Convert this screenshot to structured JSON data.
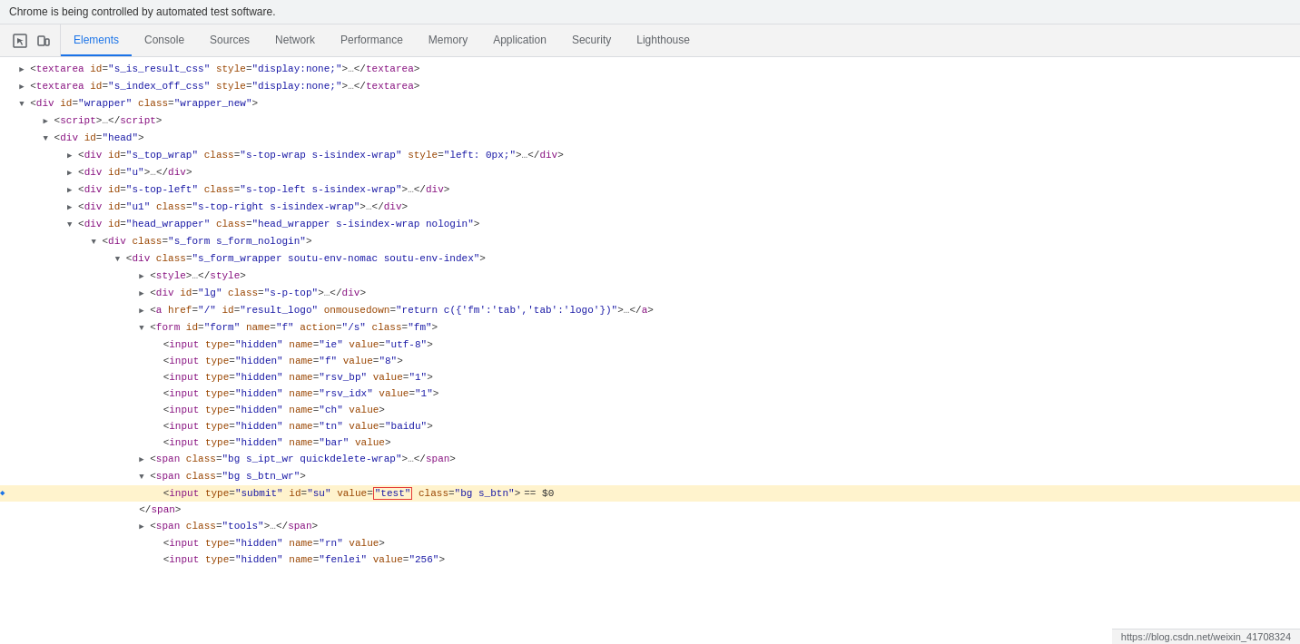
{
  "banner": {
    "text": "Chrome is being controlled by automated test software."
  },
  "toolbar": {
    "icons": [
      {
        "name": "cursor-icon",
        "symbol": "⬚"
      },
      {
        "name": "device-icon",
        "symbol": "▣"
      }
    ],
    "tabs": [
      {
        "id": "elements",
        "label": "Elements",
        "active": true
      },
      {
        "id": "console",
        "label": "Console",
        "active": false
      },
      {
        "id": "sources",
        "label": "Sources",
        "active": false
      },
      {
        "id": "network",
        "label": "Network",
        "active": false
      },
      {
        "id": "performance",
        "label": "Performance",
        "active": false
      },
      {
        "id": "memory",
        "label": "Memory",
        "active": false
      },
      {
        "id": "application",
        "label": "Application",
        "active": false
      },
      {
        "id": "security",
        "label": "Security",
        "active": false
      },
      {
        "id": "lighthouse",
        "label": "Lighthouse",
        "active": false
      }
    ]
  },
  "statusBar": {
    "url": "https://blog.csdn.net/weixin_41708324"
  },
  "codeLines": [
    {
      "indent": 0,
      "expanded": false,
      "marker": false,
      "highlighted": false,
      "html": "<span class='triangle triangle-right'></span><span class='bracket'>&lt;</span><span class='tag'>textarea</span> <span class='attr-name'>id</span><span class='equals'>=</span><span class='attr-value'>\"s_is_result_css\"</span> <span class='attr-name'>style</span><span class='equals'>=</span><span class='attr-value'>\"display:none;\"</span><span class='bracket'>&gt;</span><span class='ellipsis'>…</span><span class='bracket'>&lt;/</span><span class='tag'>textarea</span><span class='bracket'>&gt;</span>"
    },
    {
      "indent": 0,
      "expanded": false,
      "marker": false,
      "highlighted": false,
      "html": "<span class='triangle triangle-right'></span><span class='bracket'>&lt;</span><span class='tag'>textarea</span> <span class='attr-name'>id</span><span class='equals'>=</span><span class='attr-value'>\"s_index_off_css\"</span> <span class='attr-name'>style</span><span class='equals'>=</span><span class='attr-value'>\"display:none;\"</span><span class='bracket'>&gt;</span><span class='ellipsis'>…</span><span class='bracket'>&lt;/</span><span class='tag'>textarea</span><span class='bracket'>&gt;</span>"
    },
    {
      "indent": 0,
      "expanded": true,
      "marker": false,
      "highlighted": false,
      "html": "<span class='triangle triangle-down'></span><span class='bracket'>&lt;</span><span class='tag'>div</span> <span class='attr-name'>id</span><span class='equals'>=</span><span class='attr-value'>\"wrapper\"</span> <span class='attr-name'>class</span><span class='equals'>=</span><span class='attr-value'>\"wrapper_new\"</span><span class='bracket'>&gt;</span>"
    },
    {
      "indent": 1,
      "expanded": false,
      "marker": false,
      "highlighted": false,
      "html": "<span class='triangle triangle-right'></span><span class='bracket'>&lt;</span><span class='tag'>script</span><span class='bracket'>&gt;</span><span class='ellipsis'>…</span><span class='bracket'>&lt;/</span><span class='tag'>script</span><span class='bracket'>&gt;</span>"
    },
    {
      "indent": 1,
      "expanded": true,
      "marker": false,
      "highlighted": false,
      "html": "<span class='triangle triangle-down'></span><span class='bracket'>&lt;</span><span class='tag'>div</span> <span class='attr-name'>id</span><span class='equals'>=</span><span class='attr-value'>\"head\"</span><span class='bracket'>&gt;</span>"
    },
    {
      "indent": 2,
      "expanded": false,
      "marker": false,
      "highlighted": false,
      "html": "<span class='triangle triangle-right'></span><span class='bracket'>&lt;</span><span class='tag'>div</span> <span class='attr-name'>id</span><span class='equals'>=</span><span class='attr-value'>\"s_top_wrap\"</span> <span class='attr-name'>class</span><span class='equals'>=</span><span class='attr-value'>\"s-top-wrap s-isindex-wrap\"</span> <span class='attr-name'>style</span><span class='equals'>=</span><span class='attr-value'>\"left: 0px;\"</span><span class='bracket'>&gt;</span><span class='ellipsis'>…</span><span class='bracket'>&lt;/</span><span class='tag'>div</span><span class='bracket'>&gt;</span>"
    },
    {
      "indent": 2,
      "expanded": false,
      "marker": false,
      "highlighted": false,
      "html": "<span class='triangle triangle-right'></span><span class='bracket'>&lt;</span><span class='tag'>div</span> <span class='attr-name'>id</span><span class='equals'>=</span><span class='attr-value'>\"u\"</span><span class='bracket'>&gt;</span><span class='ellipsis'>…</span><span class='bracket'>&lt;/</span><span class='tag'>div</span><span class='bracket'>&gt;</span>"
    },
    {
      "indent": 2,
      "expanded": false,
      "marker": false,
      "highlighted": false,
      "html": "<span class='triangle triangle-right'></span><span class='bracket'>&lt;</span><span class='tag'>div</span> <span class='attr-name'>id</span><span class='equals'>=</span><span class='attr-value'>\"s-top-left\"</span> <span class='attr-name'>class</span><span class='equals'>=</span><span class='attr-value'>\"s-top-left s-isindex-wrap\"</span><span class='bracket'>&gt;</span><span class='ellipsis'>…</span><span class='bracket'>&lt;/</span><span class='tag'>div</span><span class='bracket'>&gt;</span>"
    },
    {
      "indent": 2,
      "expanded": false,
      "marker": false,
      "highlighted": false,
      "html": "<span class='triangle triangle-right'></span><span class='bracket'>&lt;</span><span class='tag'>div</span> <span class='attr-name'>id</span><span class='equals'>=</span><span class='attr-value'>\"u1\"</span> <span class='attr-name'>class</span><span class='equals'>=</span><span class='attr-value'>\"s-top-right s-isindex-wrap\"</span><span class='bracket'>&gt;</span><span class='ellipsis'>…</span><span class='bracket'>&lt;/</span><span class='tag'>div</span><span class='bracket'>&gt;</span>"
    },
    {
      "indent": 2,
      "expanded": true,
      "marker": false,
      "highlighted": false,
      "html": "<span class='triangle triangle-down'></span><span class='bracket'>&lt;</span><span class='tag'>div</span> <span class='attr-name'>id</span><span class='equals'>=</span><span class='attr-value'>\"head_wrapper\"</span> <span class='attr-name'>class</span><span class='equals'>=</span><span class='attr-value'>\"head_wrapper s-isindex-wrap nologin\"</span><span class='bracket'>&gt;</span>"
    },
    {
      "indent": 3,
      "expanded": true,
      "marker": false,
      "highlighted": false,
      "html": "<span class='triangle triangle-down'></span><span class='bracket'>&lt;</span><span class='tag'>div</span> <span class='attr-name'>class</span><span class='equals'>=</span><span class='attr-value'>\"s_form s_form_nologin\"</span><span class='bracket'>&gt;</span>"
    },
    {
      "indent": 4,
      "expanded": true,
      "marker": false,
      "highlighted": false,
      "html": "<span class='triangle triangle-down'></span><span class='bracket'>&lt;</span><span class='tag'>div</span> <span class='attr-name'>class</span><span class='equals'>=</span><span class='attr-value'>\"s_form_wrapper soutu-env-nomac soutu-env-index\"</span><span class='bracket'>&gt;</span>"
    },
    {
      "indent": 5,
      "expanded": false,
      "marker": false,
      "highlighted": false,
      "html": "<span class='triangle triangle-right'></span><span class='bracket'>&lt;</span><span class='tag'>style</span><span class='bracket'>&gt;</span><span class='ellipsis'>…</span><span class='bracket'>&lt;/</span><span class='tag'>style</span><span class='bracket'>&gt;</span>"
    },
    {
      "indent": 5,
      "expanded": false,
      "marker": false,
      "highlighted": false,
      "html": "<span class='triangle triangle-right'></span><span class='bracket'>&lt;</span><span class='tag'>div</span> <span class='attr-name'>id</span><span class='equals'>=</span><span class='attr-value'>\"lg\"</span> <span class='attr-name'>class</span><span class='equals'>=</span><span class='attr-value'>\"s-p-top\"</span><span class='bracket'>&gt;</span><span class='ellipsis'>…</span><span class='bracket'>&lt;/</span><span class='tag'>div</span><span class='bracket'>&gt;</span>"
    },
    {
      "indent": 5,
      "expanded": false,
      "marker": false,
      "highlighted": false,
      "html": "<span class='triangle triangle-right'></span><span class='bracket'>&lt;</span><span class='tag'>a</span> <span class='attr-name'>href</span><span class='equals'>=</span><span class='attr-value'>\"/\"</span> <span class='attr-name'>id</span><span class='equals'>=</span><span class='attr-value'>\"result_logo\"</span> <span class='attr-name'>onmousedown</span><span class='equals'>=</span><span class='attr-value'>\"return c({'fm':'tab','tab':'logo'})\"</span><span class='bracket'>&gt;</span><span class='ellipsis'>…</span><span class='bracket'>&lt;/</span><span class='tag'>a</span><span class='bracket'>&gt;</span>"
    },
    {
      "indent": 5,
      "expanded": true,
      "marker": false,
      "highlighted": false,
      "html": "<span class='triangle triangle-down'></span><span class='bracket'>&lt;</span><span class='tag'>form</span> <span class='attr-name'>id</span><span class='equals'>=</span><span class='attr-value'>\"form\"</span> <span class='attr-name'>name</span><span class='equals'>=</span><span class='attr-value'>\"f\"</span> <span class='attr-name'>action</span><span class='equals'>=</span><span class='attr-value'>\"/s\"</span> <span class='attr-name'>class</span><span class='equals'>=</span><span class='attr-value'>\"fm\"</span><span class='bracket'>&gt;</span>"
    },
    {
      "indent": 6,
      "expanded": false,
      "marker": false,
      "highlighted": false,
      "html": "<span class='bracket'>&lt;</span><span class='tag'>input</span> <span class='attr-name'>type</span><span class='equals'>=</span><span class='attr-value'>\"hidden\"</span> <span class='attr-name'>name</span><span class='equals'>=</span><span class='attr-value'>\"ie\"</span> <span class='attr-name'>value</span><span class='equals'>=</span><span class='attr-value'>\"utf-8\"</span><span class='bracket'>&gt;</span>"
    },
    {
      "indent": 6,
      "expanded": false,
      "marker": false,
      "highlighted": false,
      "html": "<span class='bracket'>&lt;</span><span class='tag'>input</span> <span class='attr-name'>type</span><span class='equals'>=</span><span class='attr-value'>\"hidden\"</span> <span class='attr-name'>name</span><span class='equals'>=</span><span class='attr-value'>\"f\"</span> <span class='attr-name'>value</span><span class='equals'>=</span><span class='attr-value'>\"8\"</span><span class='bracket'>&gt;</span>"
    },
    {
      "indent": 6,
      "expanded": false,
      "marker": false,
      "highlighted": false,
      "html": "<span class='bracket'>&lt;</span><span class='tag'>input</span> <span class='attr-name'>type</span><span class='equals'>=</span><span class='attr-value'>\"hidden\"</span> <span class='attr-name'>name</span><span class='equals'>=</span><span class='attr-value'>\"rsv_bp\"</span> <span class='attr-name'>value</span><span class='equals'>=</span><span class='attr-value'>\"1\"</span><span class='bracket'>&gt;</span>"
    },
    {
      "indent": 6,
      "expanded": false,
      "marker": false,
      "highlighted": false,
      "html": "<span class='bracket'>&lt;</span><span class='tag'>input</span> <span class='attr-name'>type</span><span class='equals'>=</span><span class='attr-value'>\"hidden\"</span> <span class='attr-name'>name</span><span class='equals'>=</span><span class='attr-value'>\"rsv_idx\"</span> <span class='attr-name'>value</span><span class='equals'>=</span><span class='attr-value'>\"1\"</span><span class='bracket'>&gt;</span>"
    },
    {
      "indent": 6,
      "expanded": false,
      "marker": false,
      "highlighted": false,
      "html": "<span class='bracket'>&lt;</span><span class='tag'>input</span> <span class='attr-name'>type</span><span class='equals'>=</span><span class='attr-value'>\"hidden\"</span> <span class='attr-name'>name</span><span class='equals'>=</span><span class='attr-value'>\"ch\"</span> <span class='attr-name'>value</span><span class='bracket'>&gt;</span>"
    },
    {
      "indent": 6,
      "expanded": false,
      "marker": false,
      "highlighted": false,
      "html": "<span class='bracket'>&lt;</span><span class='tag'>input</span> <span class='attr-name'>type</span><span class='equals'>=</span><span class='attr-value'>\"hidden\"</span> <span class='attr-name'>name</span><span class='equals'>=</span><span class='attr-value'>\"tn\"</span> <span class='attr-name'>value</span><span class='equals'>=</span><span class='attr-value'>\"baidu\"</span><span class='bracket'>&gt;</span>"
    },
    {
      "indent": 6,
      "expanded": false,
      "marker": false,
      "highlighted": false,
      "html": "<span class='bracket'>&lt;</span><span class='tag'>input</span> <span class='attr-name'>type</span><span class='equals'>=</span><span class='attr-value'>\"hidden\"</span> <span class='attr-name'>name</span><span class='equals'>=</span><span class='attr-value'>\"bar\"</span> <span class='attr-name'>value</span><span class='bracket'>&gt;</span>"
    },
    {
      "indent": 5,
      "expanded": false,
      "marker": false,
      "highlighted": false,
      "html": "<span class='triangle triangle-right'></span><span class='bracket'>&lt;</span><span class='tag'>span</span> <span class='attr-name'>class</span><span class='equals'>=</span><span class='attr-value'>\"bg s_ipt_wr quickdelete-wrap\"</span><span class='bracket'>&gt;</span><span class='ellipsis'>…</span><span class='bracket'>&lt;/</span><span class='tag'>span</span><span class='bracket'>&gt;</span>"
    },
    {
      "indent": 5,
      "expanded": true,
      "marker": false,
      "highlighted": false,
      "html": "<span class='triangle triangle-down'></span><span class='bracket'>&lt;</span><span class='tag'>span</span> <span class='attr-name'>class</span><span class='equals'>=</span><span class='attr-value'>\"bg s_btn_wr\"</span><span class='bracket'>&gt;</span>"
    },
    {
      "indent": 6,
      "expanded": false,
      "marker": true,
      "highlighted": true,
      "html": "<span class='bracket'>&lt;</span><span class='tag'>input</span> <span class='attr-name'>type</span><span class='equals'>=</span><span class='attr-value'>\"submit\"</span> <span class='attr-name'>id</span><span class='equals'>=</span><span class='attr-value'>\"su\"</span> <span class='attr-name'>value</span><span class='equals'>=</span><span class='highlighted-value'>\"test\"</span> <span class='attr-name'>class</span><span class='equals'>=</span><span class='attr-value'>\"bg s_btn\"</span><span class='bracket'>&gt;</span><span class='dom-equals'>== $0</span>"
    },
    {
      "indent": 5,
      "expanded": false,
      "marker": false,
      "highlighted": false,
      "html": "<span class='bracket'>&lt;/</span><span class='tag'>span</span><span class='bracket'>&gt;</span>"
    },
    {
      "indent": 5,
      "expanded": false,
      "marker": false,
      "highlighted": false,
      "html": "<span class='triangle triangle-right'></span><span class='bracket'>&lt;</span><span class='tag'>span</span> <span class='attr-name'>class</span><span class='equals'>=</span><span class='attr-value'>\"tools\"</span><span class='bracket'>&gt;</span><span class='ellipsis'>…</span><span class='bracket'>&lt;/</span><span class='tag'>span</span><span class='bracket'>&gt;</span>"
    },
    {
      "indent": 6,
      "expanded": false,
      "marker": false,
      "highlighted": false,
      "html": "<span class='bracket'>&lt;</span><span class='tag'>input</span> <span class='attr-name'>type</span><span class='equals'>=</span><span class='attr-value'>\"hidden\"</span> <span class='attr-name'>name</span><span class='equals'>=</span><span class='attr-value'>\"rn\"</span> <span class='attr-name'>value</span><span class='bracket'>&gt;</span>"
    },
    {
      "indent": 6,
      "expanded": false,
      "marker": false,
      "highlighted": false,
      "html": "<span class='bracket'>&lt;</span><span class='tag'>input</span> <span class='attr-name'>type</span><span class='equals'>=</span><span class='attr-value'>\"hidden\"</span> <span class='attr-name'>name</span><span class='equals'>=</span><span class='attr-value'>\"fenlei\"</span> <span class='attr-name'>value</span><span class='equals'>=</span><span class='attr-value'>\"256\"</span><span class='bracket'>&gt;</span>"
    }
  ]
}
